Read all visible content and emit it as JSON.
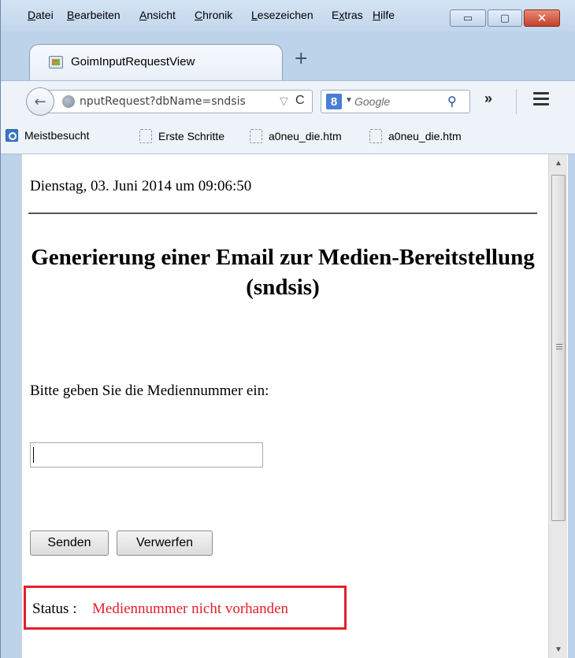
{
  "menubar": {
    "items": [
      {
        "pre": "",
        "u": "D",
        "post": "atei"
      },
      {
        "pre": "",
        "u": "B",
        "post": "earbeiten"
      },
      {
        "pre": "",
        "u": "A",
        "post": "nsicht"
      },
      {
        "pre": "",
        "u": "C",
        "post": "hronik"
      },
      {
        "pre": "",
        "u": "L",
        "post": "esezeichen"
      },
      {
        "pre": "E",
        "u": "x",
        "post": "tras"
      },
      {
        "pre": "",
        "u": "H",
        "post": "ilfe"
      }
    ]
  },
  "window_controls": {
    "minimize": "▭",
    "maximize": "▢",
    "close": "✕"
  },
  "tab": {
    "title": "GoimInputRequestView",
    "new_tab": "+"
  },
  "navbar": {
    "back": "←",
    "url": "nputRequest?dbName=sndsis",
    "star": "▽",
    "reload": "C",
    "search_engine_letter": "8",
    "search_placeholder": "Google",
    "search_icon": "⚲",
    "overflow": "»"
  },
  "bookmarks": [
    "Meistbesucht",
    "Erste Schritte",
    "a0neu_die.htm",
    "a0neu_die.htm"
  ],
  "page": {
    "datetime": "Dienstag, 03. Juni 2014 um 09:06:50",
    "heading": "Generierung einer Email zur Medien-Bereitstellung (sndsis)",
    "prompt": "Bitte geben Sie die Mediennummer ein:",
    "input_value": "",
    "send_label": "Senden",
    "discard_label": "Verwerfen",
    "status_label": "Status :",
    "status_value": "Mediennummer nicht vorhanden"
  },
  "colors": {
    "status_error": "#e3202a",
    "highlight_box": "#e3202a"
  }
}
